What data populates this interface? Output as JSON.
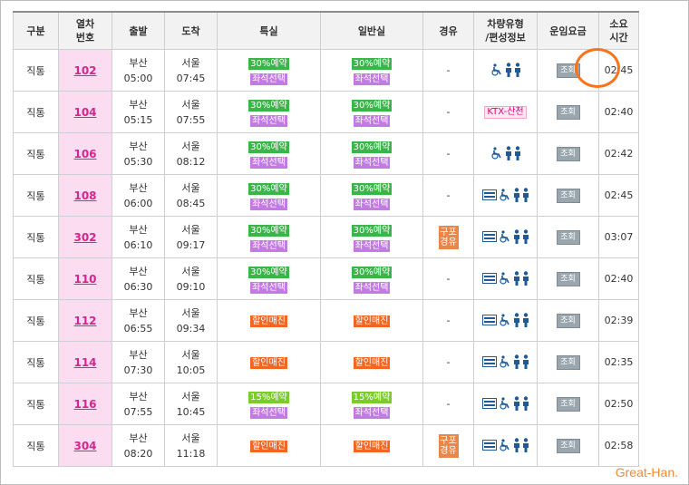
{
  "headers": [
    "구분",
    "열차\n번호",
    "출발",
    "도착",
    "특실",
    "일반실",
    "경유",
    "차량유형\n/편성정보",
    "운임요금",
    "소요\n시간"
  ],
  "rows": [
    {
      "type": "직통",
      "no": "102",
      "dep_station": "부산",
      "dep_time": "05:00",
      "arr_station": "서울",
      "arr_time": "07:45",
      "special": [
        {
          "text": "30%예약",
          "color": "green"
        },
        {
          "text": "좌석선택",
          "color": "purple"
        }
      ],
      "general": [
        {
          "text": "30%예약",
          "color": "green"
        },
        {
          "text": "좌석선택",
          "color": "purple"
        }
      ],
      "via": "-",
      "vehicle": "icons-a",
      "fare": "조회",
      "duration": "02:45"
    },
    {
      "type": "직통",
      "no": "104",
      "dep_station": "부산",
      "dep_time": "05:15",
      "arr_station": "서울",
      "arr_time": "07:55",
      "special": [
        {
          "text": "30%예약",
          "color": "green"
        },
        {
          "text": "좌석선택",
          "color": "purple"
        }
      ],
      "general": [
        {
          "text": "30%예약",
          "color": "green"
        },
        {
          "text": "좌석선택",
          "color": "purple"
        }
      ],
      "via": "-",
      "vehicle": "ktx",
      "fare": "조회",
      "duration": "02:40"
    },
    {
      "type": "직통",
      "no": "106",
      "dep_station": "부산",
      "dep_time": "05:30",
      "arr_station": "서울",
      "arr_time": "08:12",
      "special": [
        {
          "text": "30%예약",
          "color": "green"
        },
        {
          "text": "좌석선택",
          "color": "purple"
        }
      ],
      "general": [
        {
          "text": "30%예약",
          "color": "green"
        },
        {
          "text": "좌석선택",
          "color": "purple"
        }
      ],
      "via": "-",
      "vehicle": "icons-a",
      "fare": "조회",
      "duration": "02:42"
    },
    {
      "type": "직통",
      "no": "108",
      "dep_station": "부산",
      "dep_time": "06:00",
      "arr_station": "서울",
      "arr_time": "08:45",
      "special": [
        {
          "text": "30%예약",
          "color": "green"
        },
        {
          "text": "좌석선택",
          "color": "purple"
        }
      ],
      "general": [
        {
          "text": "30%예약",
          "color": "green"
        },
        {
          "text": "좌석선택",
          "color": "purple"
        }
      ],
      "via": "-",
      "vehicle": "icons-b",
      "fare": "조회",
      "duration": "02:45"
    },
    {
      "type": "직통",
      "no": "302",
      "dep_station": "부산",
      "dep_time": "06:10",
      "arr_station": "서울",
      "arr_time": "09:17",
      "special": [
        {
          "text": "30%예약",
          "color": "green"
        },
        {
          "text": "좌석선택",
          "color": "purple"
        }
      ],
      "general": [
        {
          "text": "30%예약",
          "color": "green"
        },
        {
          "text": "좌석선택",
          "color": "purple"
        }
      ],
      "via": "구포\n경유",
      "vehicle": "icons-b",
      "fare": "조회",
      "duration": "03:07"
    },
    {
      "type": "직통",
      "no": "110",
      "dep_station": "부산",
      "dep_time": "06:30",
      "arr_station": "서울",
      "arr_time": "09:10",
      "special": [
        {
          "text": "30%예약",
          "color": "green"
        },
        {
          "text": "좌석선택",
          "color": "purple"
        }
      ],
      "general": [
        {
          "text": "30%예약",
          "color": "green"
        },
        {
          "text": "좌석선택",
          "color": "purple"
        }
      ],
      "via": "-",
      "vehicle": "icons-b",
      "fare": "조회",
      "duration": "02:40"
    },
    {
      "type": "직통",
      "no": "112",
      "dep_station": "부산",
      "dep_time": "06:55",
      "arr_station": "서울",
      "arr_time": "09:34",
      "special": [
        {
          "text": "할인매진",
          "color": "orange"
        }
      ],
      "general": [
        {
          "text": "할인매진",
          "color": "orange"
        }
      ],
      "via": "-",
      "vehicle": "icons-b",
      "fare": "조회",
      "duration": "02:39"
    },
    {
      "type": "직통",
      "no": "114",
      "dep_station": "부산",
      "dep_time": "07:30",
      "arr_station": "서울",
      "arr_time": "10:05",
      "special": [
        {
          "text": "할인매진",
          "color": "orange"
        }
      ],
      "general": [
        {
          "text": "할인매진",
          "color": "orange"
        }
      ],
      "via": "-",
      "vehicle": "icons-b",
      "fare": "조회",
      "duration": "02:35"
    },
    {
      "type": "직통",
      "no": "116",
      "dep_station": "부산",
      "dep_time": "07:55",
      "arr_station": "서울",
      "arr_time": "10:45",
      "special": [
        {
          "text": "15%예약",
          "color": "lgreen"
        },
        {
          "text": "좌석선택",
          "color": "purple"
        }
      ],
      "general": [
        {
          "text": "15%예약",
          "color": "lgreen"
        },
        {
          "text": "좌석선택",
          "color": "purple"
        }
      ],
      "via": "-",
      "vehicle": "icons-b",
      "fare": "조회",
      "duration": "02:50"
    },
    {
      "type": "직통",
      "no": "304",
      "dep_station": "부산",
      "dep_time": "08:20",
      "arr_station": "서울",
      "arr_time": "11:18",
      "special": [
        {
          "text": "할인매진",
          "color": "orange"
        }
      ],
      "general": [
        {
          "text": "할인매진",
          "color": "orange"
        }
      ],
      "via": "구포\n경유",
      "vehicle": "icons-b",
      "fare": "조회",
      "duration": "02:58"
    }
  ],
  "vehicle_labels": {
    "ktx": "KTX-산천"
  },
  "watermark": "Great-Han.",
  "colors": {
    "highlight_circle": "#f7741f",
    "train_no": "#d6258c",
    "train_no_bg": "#fbdcf0",
    "icon_blue": "#1f5a96"
  }
}
